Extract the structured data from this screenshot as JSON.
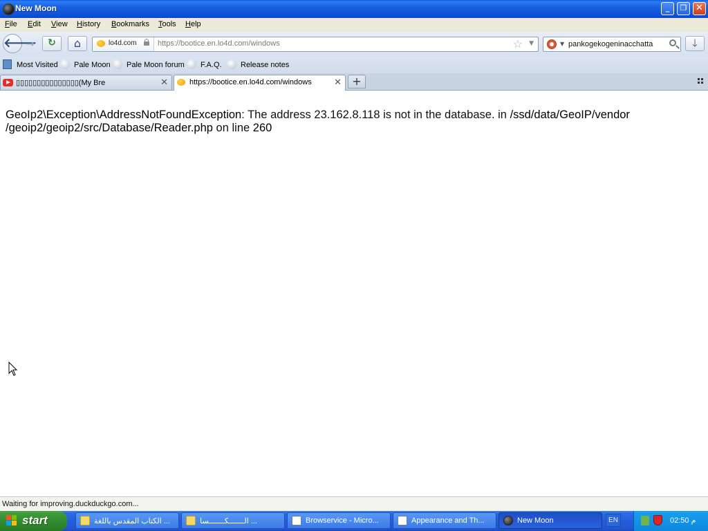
{
  "window": {
    "title": "New Moon",
    "minimize": "_",
    "restore": "❐",
    "close": "✕"
  },
  "menu": [
    "File",
    "Edit",
    "View",
    "History",
    "Bookmarks",
    "Tools",
    "Help"
  ],
  "menu_underline": [
    "F",
    "E",
    "V",
    "H",
    "B",
    "T",
    "H"
  ],
  "navbar": {
    "back_glyph": "🡐",
    "forward_glyph": "→",
    "reload_glyph": "↻",
    "home_glyph": "⌂",
    "identity_domain": "lo4d.com",
    "url": "https://bootice.en.lo4d.com/windows",
    "bookmark_star": "☆",
    "url_dropdown": "▼",
    "search_engine_dropdown": "▼",
    "search_text": "pankogekogeninacchatta",
    "download_glyph": "🡓"
  },
  "bookmarks": [
    {
      "label": "Most Visited",
      "icon": "most-visited-icon"
    },
    {
      "label": "Pale Moon",
      "icon": "globe-icon"
    },
    {
      "label": "Pale Moon forum",
      "icon": "globe-icon"
    },
    {
      "label": "F.A.Q.",
      "icon": "globe-icon"
    },
    {
      "label": "Release notes",
      "icon": "globe-icon"
    }
  ],
  "tabs": [
    {
      "title": "▯▯▯▯▯▯▯▯▯▯▯▯▯▯▯(My Bre",
      "icon": "youtube-icon",
      "close": "✕",
      "active": false
    },
    {
      "title": "https://bootice.en.lo4d.com/windows",
      "icon": "lo4d-icon",
      "close": "✕",
      "active": true
    }
  ],
  "new_tab_glyph": "+",
  "content": {
    "error_class": "GeoIp2\\Exception\\AddressNotFoundException",
    "error_text": ": The address 23.162.8.118 is not in the database. in ",
    "error_file": "/ssd/data/GeoIP/vendor /geoip2/geoip2/src/Database/Reader.php",
    "error_line_prefix": " on line ",
    "error_line": "260"
  },
  "status": "Waiting for improving.duckduckgo.com...",
  "taskbar": {
    "start_label": "start",
    "tasks": [
      {
        "label": "الكتاب المقدس باللغة ...",
        "icon": "help-icon"
      },
      {
        "label": "الـــــــكـــــــسا ...",
        "icon": "help-icon"
      },
      {
        "label": "Browservice - Micro...",
        "icon": "document-icon"
      },
      {
        "label": "Appearance and Th...",
        "icon": "document-icon"
      },
      {
        "label": "New Moon",
        "icon": "new-moon-icon"
      }
    ],
    "active_task": 4,
    "language": "EN",
    "clock": "02:50 م"
  },
  "colors": {
    "titlebar": "#0b4fd6",
    "taskbar": "#245ddb",
    "start_button": "#3c9a3a",
    "tray": "#0e88dd"
  }
}
